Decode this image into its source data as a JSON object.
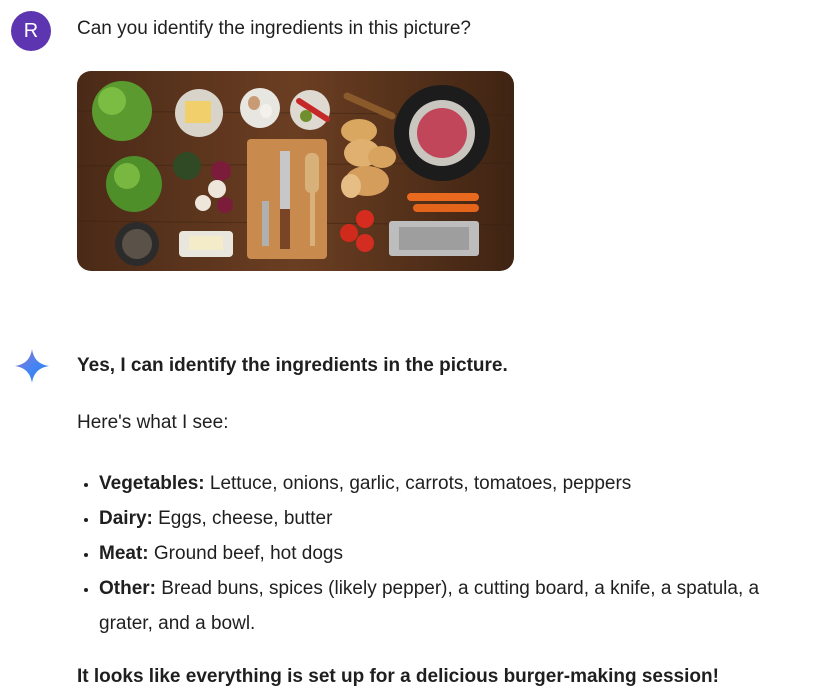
{
  "user": {
    "avatar_initial": "R",
    "avatar_color": "#5e35b1",
    "prompt": "Can you identify the ingredients in this picture?"
  },
  "image": {
    "icon": "photo-of-burger-ingredients"
  },
  "assistant": {
    "icon": "sparkle-icon",
    "lead": "Yes, I can identify the ingredients in the picture.",
    "intro": "Here's what I see:",
    "items": [
      {
        "label": "Vegetables:",
        "text": " Lettuce, onions, garlic, carrots, tomatoes, peppers"
      },
      {
        "label": "Dairy:",
        "text": " Eggs, cheese, butter"
      },
      {
        "label": "Meat:",
        "text": " Ground beef, hot dogs"
      },
      {
        "label": "Other:",
        "text": " Bread buns, spices (likely pepper), a cutting board, a knife, a spatula, a grater, and a bowl."
      }
    ],
    "closing": "It looks like everything is set up for a delicious burger-making session!"
  }
}
